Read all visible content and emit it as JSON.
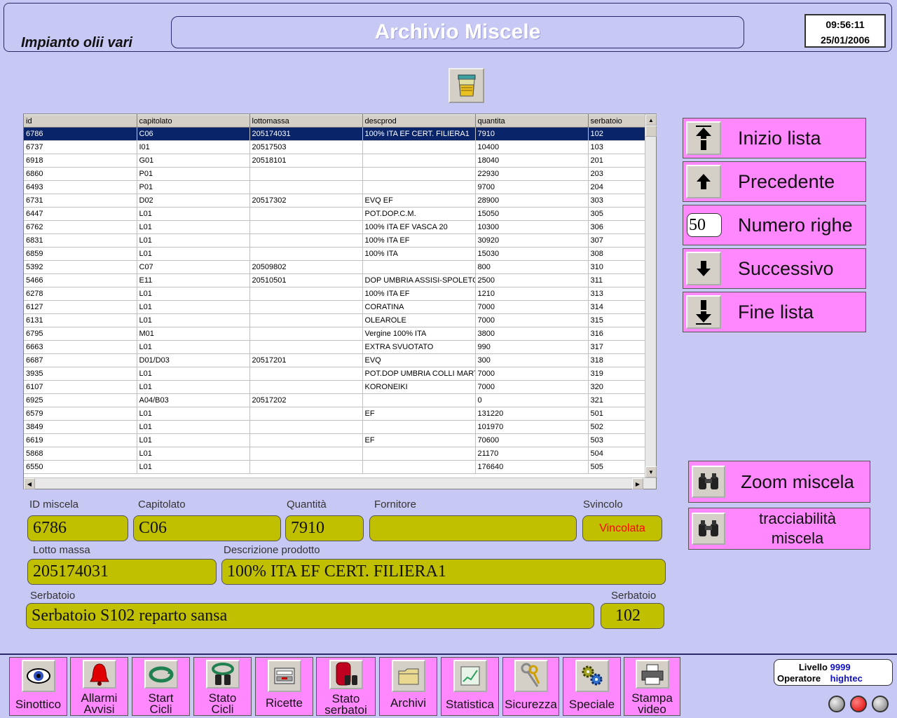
{
  "header": {
    "plant": "Impianto olii vari",
    "title": "Archivio Miscele",
    "time": "09:56:11",
    "date": "25/01/2006"
  },
  "grid": {
    "columns": [
      "id",
      "capitolato",
      "lottomassa",
      "descprod",
      "quantita",
      "serbatoio"
    ],
    "rows": [
      [
        "6786",
        "C06",
        "205174031",
        "100% ITA EF CERT. FILIERA1",
        "7910",
        "102"
      ],
      [
        "6737",
        "I01",
        "20517503",
        "",
        "10400",
        "103"
      ],
      [
        "6918",
        "G01",
        "20518101",
        "",
        "18040",
        "201"
      ],
      [
        "6860",
        "P01",
        "",
        "",
        "22930",
        "203"
      ],
      [
        "6493",
        "P01",
        "",
        "",
        "9700",
        "204"
      ],
      [
        "6731",
        "D02",
        "20517302",
        "EVQ  EF",
        "28900",
        "303"
      ],
      [
        "6447",
        "L01",
        "",
        "POT.DOP.C.M.",
        "15050",
        "305"
      ],
      [
        "6762",
        "L01",
        "",
        "100% ITA EF VASCA 20",
        "10300",
        "306"
      ],
      [
        "6831",
        "L01",
        "",
        "100% ITA EF",
        "30920",
        "307"
      ],
      [
        "6859",
        "L01",
        "",
        "100% ITA",
        "15030",
        "308"
      ],
      [
        "5392",
        "C07",
        "20509802",
        "",
        "800",
        "310"
      ],
      [
        "5466",
        "E11",
        "20510501",
        "DOP UMBRIA ASSISI-SPOLETO",
        "2500",
        "311"
      ],
      [
        "6278",
        "L01",
        "",
        "100% ITA EF",
        "1210",
        "313"
      ],
      [
        "6127",
        "L01",
        "",
        "CORATINA",
        "7000",
        "314"
      ],
      [
        "6131",
        "L01",
        "",
        "OLEAROLE",
        "7000",
        "315"
      ],
      [
        "6795",
        "M01",
        "",
        "Vergine 100% ITA",
        "3800",
        "316"
      ],
      [
        "6663",
        "L01",
        "",
        "EXTRA SVUOTATO",
        "990",
        "317"
      ],
      [
        "6687",
        "D01/D03",
        "20517201",
        "EVQ",
        "300",
        "318"
      ],
      [
        "3935",
        "L01",
        "",
        "POT.DOP UMBRIA COLLI MART",
        "7000",
        "319"
      ],
      [
        "6107",
        "L01",
        "",
        "KORONEIKI",
        "7000",
        "320"
      ],
      [
        "6925",
        "A04/B03",
        "20517202",
        "",
        "0",
        "321"
      ],
      [
        "6579",
        "L01",
        "",
        "EF",
        "131220",
        "501"
      ],
      [
        "3849",
        "L01",
        "",
        "",
        "101970",
        "502"
      ],
      [
        "6619",
        "L01",
        "",
        "EF",
        "70600",
        "503"
      ],
      [
        "5868",
        "L01",
        "",
        "",
        "21170",
        "504"
      ],
      [
        "6550",
        "L01",
        "",
        "",
        "176640",
        "505"
      ]
    ]
  },
  "nav": {
    "first": "Inizio lista",
    "prev": "Precedente",
    "rows_label": "Numero righe",
    "rows_value": "50",
    "next": "Successivo",
    "last": "Fine lista"
  },
  "actions": {
    "zoom": "Zoom miscela",
    "trace_line1": "tracciabilità",
    "trace_line2": "miscela"
  },
  "details": {
    "id_label": "ID miscela",
    "id_value": "6786",
    "cap_label": "Capitolato",
    "cap_value": "C06",
    "qty_label": "Quantità",
    "qty_value": "7910",
    "forn_label": "Fornitore",
    "forn_value": "",
    "svinc_label": "Svincolo",
    "svinc_value": "Vincolata",
    "lotto_label": "Lotto massa",
    "lotto_value": "205174031",
    "desc_label": "Descrizione prodotto",
    "desc_value": "100% ITA EF CERT. FILIERA1",
    "serb_label": "Serbatoio",
    "serb_value": "Serbatoio S102 reparto sansa",
    "serbno_label": "Serbatoio",
    "serbno_value": "102"
  },
  "bottom": {
    "sinottico": "Sinottico",
    "allarmi": [
      "Allarmi",
      "Avvisi"
    ],
    "start": [
      "Start",
      "Cicli"
    ],
    "stato_cicli": [
      "Stato",
      "Cicli"
    ],
    "ricette": "Ricette",
    "stato_serb": [
      "Stato",
      "serbatoi"
    ],
    "archivi": "Archivi",
    "statistica": "Statistica",
    "sicurezza": "Sicurezza",
    "speciale": "Speciale",
    "stampa": [
      "Stampa",
      "video"
    ]
  },
  "status": {
    "livello_label": "Livello",
    "livello_value": "9999",
    "operatore_label": "Operatore",
    "operatore_value": "hightec"
  },
  "colors": {
    "background": "#c8c8f4",
    "button": "#ff88ff",
    "field": "#c0c000",
    "selection": "#0a246a",
    "alert": "#ff0000"
  }
}
